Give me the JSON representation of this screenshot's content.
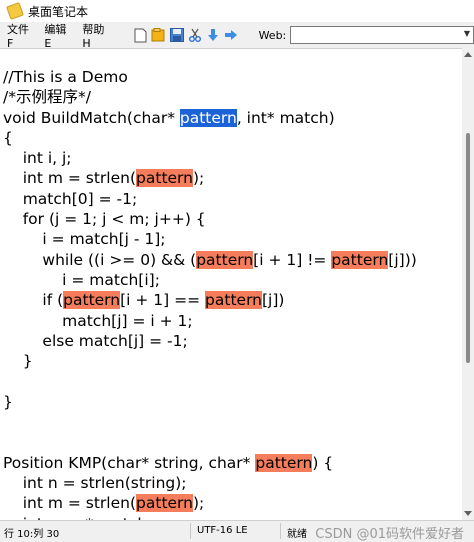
{
  "window": {
    "title": "桌面笔记本"
  },
  "menu": {
    "file": "文件F",
    "edit": "编辑E",
    "help": "帮助H"
  },
  "toolbar": {
    "web_label": "Web:",
    "web_value": ""
  },
  "status": {
    "position": "行 10:列 30",
    "encoding": "UTF-16 LE",
    "state": "就绪"
  },
  "watermark": "CSDN @01码软件爱好者",
  "code_lines": [
    [
      [
        "//This is a Demo",
        ""
      ]
    ],
    [
      [
        "/*示例程序*/",
        ""
      ]
    ],
    [
      [
        "void BuildMatch(char* ",
        ""
      ],
      [
        "pattern",
        "sel"
      ],
      [
        ", int* match)",
        ""
      ]
    ],
    [
      [
        "{",
        ""
      ]
    ],
    [
      [
        "    int i, j;",
        ""
      ]
    ],
    [
      [
        "    int m = strlen(",
        ""
      ],
      [
        "pattern",
        "hl"
      ],
      [
        ");",
        ""
      ]
    ],
    [
      [
        "    match[0] = -1;",
        ""
      ]
    ],
    [
      [
        "    for (j = 1; j < m; j++) {",
        ""
      ]
    ],
    [
      [
        "        i = match[j - 1];",
        ""
      ]
    ],
    [
      [
        "        while ((i >= 0) && (",
        ""
      ],
      [
        "pattern",
        "hl"
      ],
      [
        "[i + 1] != ",
        ""
      ],
      [
        "pattern",
        "hl"
      ],
      [
        "[j]))",
        ""
      ]
    ],
    [
      [
        "            i = match[i];",
        ""
      ]
    ],
    [
      [
        "        if (",
        ""
      ],
      [
        "pattern",
        "hl"
      ],
      [
        "[i + 1] == ",
        ""
      ],
      [
        "pattern",
        "hl"
      ],
      [
        "[j])",
        ""
      ]
    ],
    [
      [
        "            match[j] = i + 1;",
        ""
      ]
    ],
    [
      [
        "        else match[j] = -1;",
        ""
      ]
    ],
    [
      [
        "    }",
        ""
      ]
    ],
    [
      [
        "",
        ""
      ]
    ],
    [
      [
        "}",
        ""
      ]
    ],
    [
      [
        "",
        ""
      ]
    ],
    [
      [
        "",
        ""
      ]
    ],
    [
      [
        "Position KMP(char* string, char* ",
        ""
      ],
      [
        "pattern",
        "hl"
      ],
      [
        ") {",
        ""
      ]
    ],
    [
      [
        "    int n = strlen(string);",
        ""
      ]
    ],
    [
      [
        "    int m = strlen(",
        ""
      ],
      [
        "pattern",
        "hl"
      ],
      [
        ");",
        ""
      ]
    ],
    [
      [
        "    int s, p, * match;",
        ""
      ]
    ]
  ]
}
